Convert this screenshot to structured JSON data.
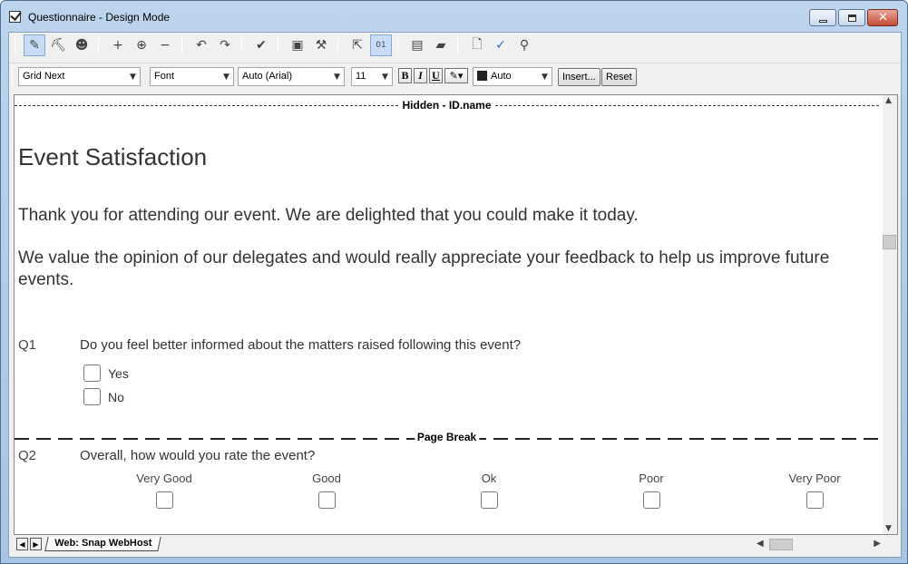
{
  "window": {
    "title": "Questionnaire - Design Mode",
    "caption_min": "minimize",
    "caption_max": "maximize",
    "caption_close": "✕"
  },
  "toolbar": {
    "icons": [
      "design-mode-icon",
      "format-painter-icon",
      "users-icon",
      "add-question-icon",
      "add-multiple-icon",
      "remove-icon",
      "undo-icon",
      "redo-icon",
      "check-icon",
      "properties-icon",
      "script-icon",
      "cursor-icon",
      "numbering-icon",
      "layout-icon",
      "stack-icon",
      "preview-icon",
      "spellcheck-icon",
      "find-icon"
    ]
  },
  "format_bar": {
    "style": "Grid Next",
    "font_style": "Font",
    "font_name": "Auto (Arial)",
    "font_size": "11",
    "bold": "B",
    "italic": "I",
    "underline": "U",
    "color": "Auto",
    "insert_label": "Insert...",
    "reset_label": "Reset"
  },
  "document": {
    "hidden_marker": "Hidden - ID.name",
    "title": "Event Satisfaction",
    "intro1": "Thank you for attending our event. We are delighted that you could make it today.",
    "intro2": "We value the opinion of our delegates and would really appreciate your feedback to help us improve future events.",
    "page_break": "Page Break",
    "q1": {
      "number": "Q1",
      "text": "Do you feel better informed about the matters raised following this event?",
      "options": [
        "Yes",
        "No"
      ]
    },
    "q2": {
      "number": "Q2",
      "text": "Overall, how would you rate the event?",
      "scale": [
        "Very Good",
        "Good",
        "Ok",
        "Poor",
        "Very Poor"
      ]
    }
  },
  "bottom": {
    "nav_prev": "◀",
    "nav_next": "▶",
    "sheet_tab": "Web: Snap WebHost"
  }
}
